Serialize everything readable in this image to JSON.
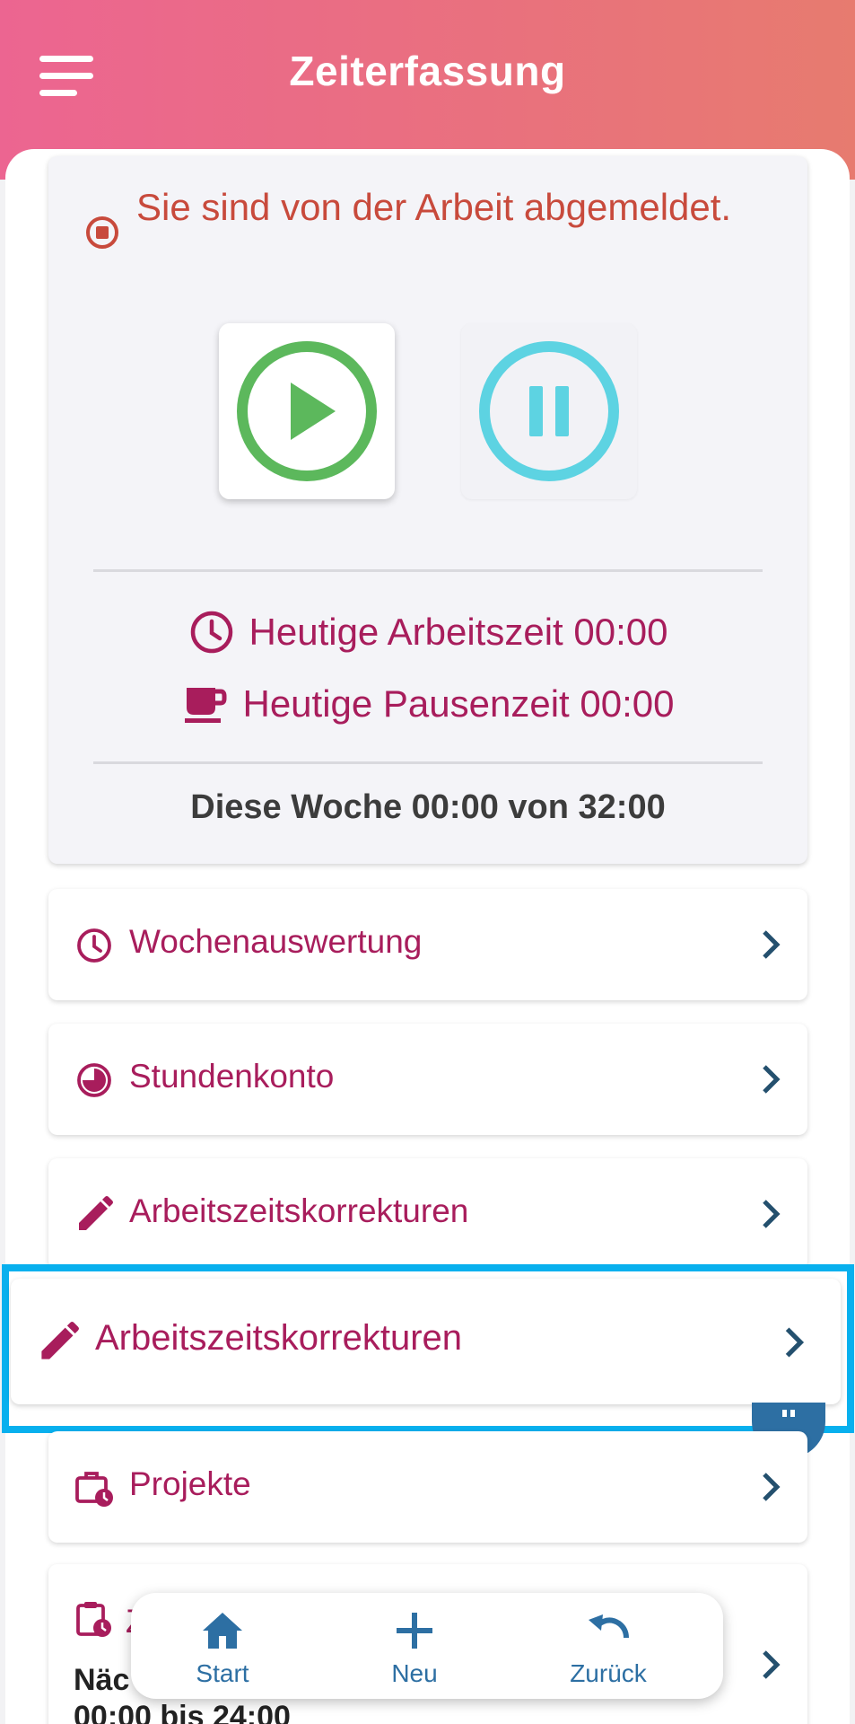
{
  "header": {
    "title": "Zeiterfassung"
  },
  "status": {
    "message": "Sie sind von der Arbeit abgemeldet.",
    "today_work": "Heutige Arbeitszeit 00:00",
    "today_break": "Heutige Pausenzeit 00:00",
    "week": "Diese Woche 00:00 von 32:00"
  },
  "menu": {
    "items": [
      {
        "label": "Wochenauswertung",
        "icon": "clock-icon"
      },
      {
        "label": "Stundenkonto",
        "icon": "pie-clock-icon"
      },
      {
        "label": "Arbeitszeitskorrekturen",
        "icon": "pencil-icon"
      },
      {
        "label": "Arbeitszeitskorrekturen",
        "icon": "pencil-icon"
      },
      {
        "label": "Projekte",
        "icon": "briefcase-clock-icon"
      }
    ],
    "partial": {
      "title": "Z",
      "bold_line": "Näc",
      "time_line": "00:00 bis 24:00"
    }
  },
  "bottom_nav": {
    "start": "Start",
    "neu": "Neu",
    "zurueck": "Zurück"
  },
  "colors": {
    "accent": "#a81d5c",
    "alert": "#c84a3c",
    "nav": "#2d6fa3",
    "highlight": "#08b0ee"
  }
}
